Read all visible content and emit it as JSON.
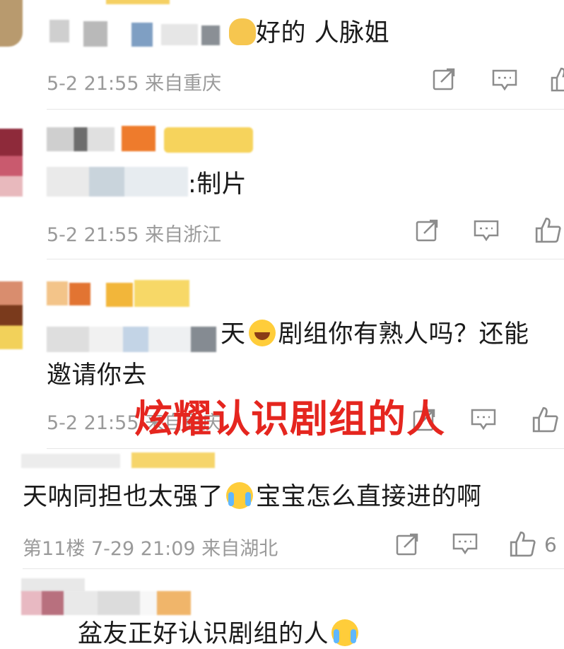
{
  "comments": [
    {
      "text": "好的 人脉姐",
      "meta": "5-2 21:55 来自重庆"
    },
    {
      "text": ":制片",
      "meta": "5-2 21:55 来自浙江"
    },
    {
      "text_part1": "天",
      "text_part2": "剧组你有熟人吗？还能",
      "text_line2": "邀请你去",
      "meta": "5-2 21:55 来自重庆"
    },
    {
      "text_part1": "天呐同担也太强了",
      "text_part2": "宝宝怎么直接进的啊",
      "meta": "第11楼 7-29 21:09 来自湖北",
      "likes": "6"
    },
    {
      "text_part1": "盆友正好认识剧组的人"
    }
  ],
  "overlay": {
    "caption": "炫耀认识剧组的人",
    "color": "#e5261f"
  },
  "icons": {
    "share": "share-icon",
    "comment": "comment-icon",
    "like": "thumbs-up-icon"
  }
}
